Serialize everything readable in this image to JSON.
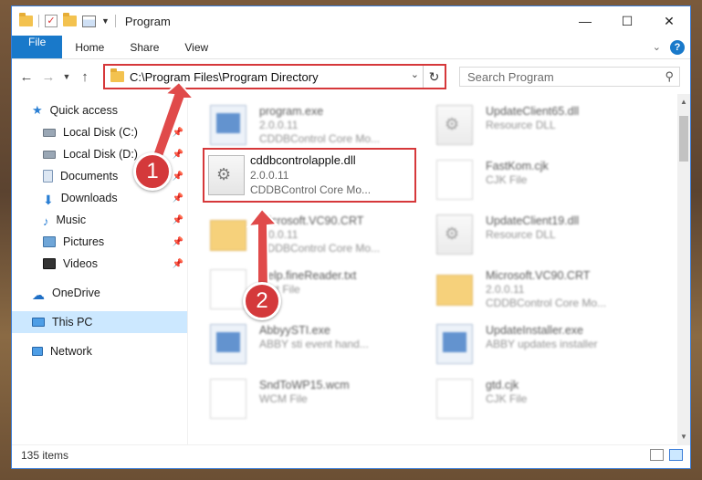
{
  "window": {
    "title": "Program",
    "controls": {
      "minimize": "—",
      "maximize": "☐",
      "close": "✕"
    }
  },
  "ribbon": {
    "tabs": [
      "File",
      "Home",
      "Share",
      "View"
    ],
    "expand_icon": "chevron-down-icon",
    "help_label": "?"
  },
  "address": {
    "path": "C:\\Program Files\\Program Directory",
    "search_placeholder": "Search Program"
  },
  "sidebar": {
    "items": [
      {
        "label": "Quick access",
        "icon": "star-icon",
        "pinned": false
      },
      {
        "label": "Local Disk (C:)",
        "icon": "drive-icon",
        "pinned": true
      },
      {
        "label": "Local Disk (D:)",
        "icon": "drive-icon",
        "pinned": true
      },
      {
        "label": "Documents",
        "icon": "documents-icon",
        "pinned": true
      },
      {
        "label": "Downloads",
        "icon": "download-icon",
        "pinned": true
      },
      {
        "label": "Music",
        "icon": "music-icon",
        "pinned": true
      },
      {
        "label": "Pictures",
        "icon": "pictures-icon",
        "pinned": true
      },
      {
        "label": "Videos",
        "icon": "videos-icon",
        "pinned": true
      },
      {
        "label": "OneDrive",
        "icon": "cloud-icon"
      },
      {
        "label": "This PC",
        "icon": "computer-icon",
        "selected": true
      },
      {
        "label": "Network",
        "icon": "network-icon"
      }
    ]
  },
  "files": {
    "left": [
      {
        "name": "program.exe",
        "line1": "2.0.0.11",
        "line2": "CDDBControl Core Mo...",
        "kind": "exe"
      },
      {
        "name": "cddbcontrolapple.dll",
        "line1": "2.0.0.11",
        "line2": "CDDBControl Core Mo...",
        "kind": "dll"
      },
      {
        "name": "Microsoft.VC90.CRT",
        "line1": "2.0.0.11",
        "line2": "CDDBControl Core Mo...",
        "kind": "folder"
      },
      {
        "name": "Help.fineReader.txt",
        "line1": "Text File",
        "line2": "",
        "kind": "txt"
      },
      {
        "name": "AbbyySTI.exe",
        "line1": "ABBY sti event hand...",
        "line2": "",
        "kind": "exe"
      },
      {
        "name": "SndToWP15.wcm",
        "line1": "WCM File",
        "line2": "",
        "kind": "txt"
      }
    ],
    "right": [
      {
        "name": "UpdateClient65.dll",
        "line1": "Resource DLL",
        "line2": "",
        "kind": "dll"
      },
      {
        "name": "FastKom.cjk",
        "line1": "CJK File",
        "line2": "",
        "kind": "cjk"
      },
      {
        "name": "UpdateClient19.dll",
        "line1": "Resource DLL",
        "line2": "",
        "kind": "dll"
      },
      {
        "name": "Microsoft.VC90.CRT",
        "line1": "2.0.0.11",
        "line2": "CDDBControl Core Mo...",
        "kind": "folder"
      },
      {
        "name": "UpdateInstaller.exe",
        "line1": "ABBY updates installer",
        "line2": "",
        "kind": "exe"
      },
      {
        "name": "gtd.cjk",
        "line1": "CJK File",
        "line2": "",
        "kind": "cjk"
      }
    ]
  },
  "status": {
    "count": "135 items"
  },
  "annotations": {
    "step1": "1",
    "step2": "2",
    "accent": "#d6383a"
  }
}
